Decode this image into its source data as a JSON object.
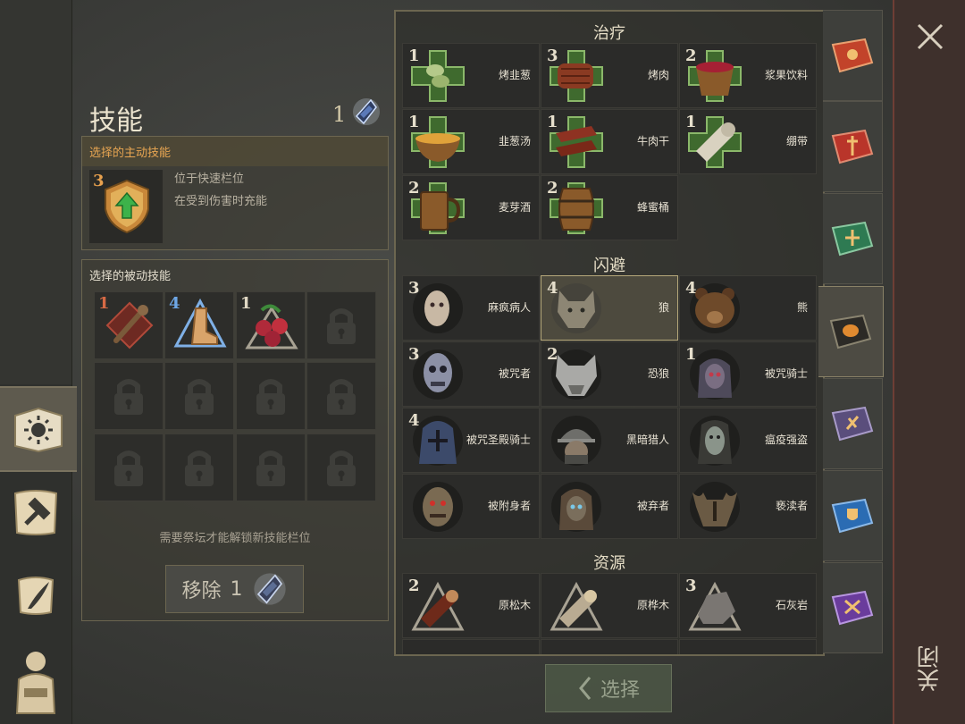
{
  "skills": {
    "title": "技能",
    "shard_count": "1",
    "active_header": "选择的主动技能",
    "active_skill": {
      "level": "3",
      "line1": "位于快速栏位",
      "line2": "在受到伤害时充能"
    },
    "passive_header": "选择的被动技能",
    "passive_slots": [
      {
        "level": "1",
        "icon": "club-skill-icon",
        "color": "#d76a45"
      },
      {
        "level": "4",
        "icon": "boot-skill-icon",
        "color": "#6ea7e6"
      },
      {
        "level": "1",
        "icon": "berries-skill-icon",
        "color": "#e0d8c4"
      }
    ],
    "hint": "需要祭坛才能解锁新技能栏位",
    "remove_label": "移除",
    "remove_count": "1"
  },
  "list": {
    "healing": {
      "title": "治疗",
      "items": [
        {
          "level": "1",
          "name": "烤韭葱",
          "icon": "roasted-leek-icon"
        },
        {
          "level": "3",
          "name": "烤肉",
          "icon": "roasted-meat-icon"
        },
        {
          "level": "2",
          "name": "浆果饮料",
          "icon": "berry-drink-icon"
        },
        {
          "level": "1",
          "name": "韭葱汤",
          "icon": "leek-soup-icon"
        },
        {
          "level": "1",
          "name": "牛肉干",
          "icon": "jerky-icon"
        },
        {
          "level": "1",
          "name": "绷带",
          "icon": "bandage-icon"
        },
        {
          "level": "2",
          "name": "麦芽酒",
          "icon": "ale-mug-icon"
        },
        {
          "level": "2",
          "name": "蜂蜜桶",
          "icon": "honey-barrel-icon"
        }
      ]
    },
    "evasion": {
      "title": "闪避",
      "items": [
        {
          "level": "3",
          "name": "麻疯病人",
          "icon": "leper-icon"
        },
        {
          "level": "4",
          "name": "狼",
          "icon": "wolf-icon",
          "selected": true
        },
        {
          "level": "4",
          "name": "熊",
          "icon": "bear-icon"
        },
        {
          "level": "3",
          "name": "被咒者",
          "icon": "cursed-icon"
        },
        {
          "level": "2",
          "name": "恐狼",
          "icon": "dire-wolf-icon"
        },
        {
          "level": "1",
          "name": "被咒骑士",
          "icon": "cursed-knight-icon"
        },
        {
          "level": "4",
          "name": "被咒圣殿骑士",
          "icon": "cursed-templar-icon"
        },
        {
          "level": "",
          "name": "黑暗猎人",
          "icon": "dark-hunter-icon"
        },
        {
          "level": "",
          "name": "瘟疫强盗",
          "icon": "plague-bandit-icon"
        },
        {
          "level": "",
          "name": "被附身者",
          "icon": "possessed-icon"
        },
        {
          "level": "",
          "name": "被弃者",
          "icon": "forsaken-icon"
        },
        {
          "level": "",
          "name": "亵渎者",
          "icon": "defiler-icon"
        }
      ]
    },
    "resources": {
      "title": "资源",
      "items": [
        {
          "level": "2",
          "name": "原松木",
          "icon": "pine-log-icon"
        },
        {
          "level": "",
          "name": "原桦木",
          "icon": "birch-log-icon"
        },
        {
          "level": "3",
          "name": "石灰岩",
          "icon": "limestone-icon"
        }
      ]
    }
  },
  "book_tabs": [
    {
      "icon": "sun-book-icon",
      "color": "#c2432a"
    },
    {
      "icon": "sword-book-icon",
      "color": "#b9352a"
    },
    {
      "icon": "cross-book-icon",
      "color": "#2e7a52"
    },
    {
      "icon": "mask-book-icon",
      "color": "#2c2a26",
      "active": true
    },
    {
      "icon": "dagger-book-icon",
      "color": "#5a4e7c"
    },
    {
      "icon": "shield-book-icon",
      "color": "#2b6cb3"
    },
    {
      "icon": "star-book-icon",
      "color": "#6a3c9c"
    }
  ],
  "select_label": "选择",
  "close_label": "关闭"
}
